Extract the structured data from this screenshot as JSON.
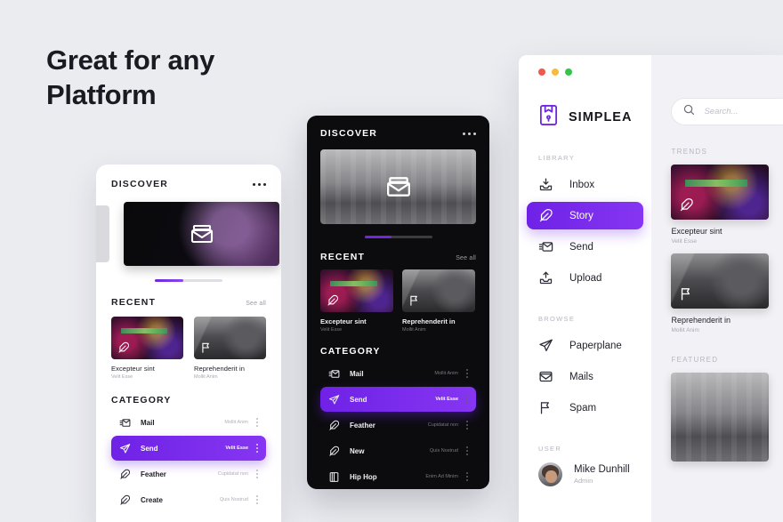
{
  "headline": {
    "line1": "Great for any",
    "line2": "Platform"
  },
  "colors": {
    "accent": "#7225e8",
    "accent_light": "#8636f2",
    "dark_bg": "#0c0c0e",
    "page_bg": "#ebecf0"
  },
  "phone_left": {
    "header_title": "DISCOVER",
    "menu_icon": "more-horizontal-icon",
    "hero_icon": "mail-icon",
    "recent": {
      "title": "RECENT",
      "see_all": "See all",
      "cards": [
        {
          "title": "Excepteur sint",
          "subtitle": "Velit Esse",
          "icon": "feather-icon"
        },
        {
          "title": "Reprehenderit in",
          "subtitle": "Mollit Anim",
          "icon": "flag-icon"
        }
      ]
    },
    "category": {
      "title": "CATEGORY",
      "items": [
        {
          "label": "Mail",
          "meta": "Mollit Anim",
          "icon": "inbox-mail-icon",
          "active": false
        },
        {
          "label": "Send",
          "meta": "Velit Esse",
          "icon": "paperplane-icon",
          "active": true
        },
        {
          "label": "Feather",
          "meta": "Cupidatat non",
          "icon": "feather-icon",
          "active": false
        },
        {
          "label": "Create",
          "meta": "Quis Nostrud",
          "icon": "feather-icon",
          "active": false
        }
      ]
    }
  },
  "phone_mid": {
    "header_title": "DISCOVER",
    "menu_icon": "more-horizontal-icon",
    "hero_icon": "mail-icon",
    "recent": {
      "title": "RECENT",
      "see_all": "See all",
      "cards": [
        {
          "title": "Excepteur sint",
          "subtitle": "Velit Esse",
          "icon": "feather-icon"
        },
        {
          "title": "Reprehenderit in",
          "subtitle": "Mollit Anim",
          "icon": "flag-icon"
        }
      ]
    },
    "category": {
      "title": "CATEGORY",
      "items": [
        {
          "label": "Mail",
          "meta": "Mollit Anim",
          "icon": "inbox-mail-icon",
          "active": false
        },
        {
          "label": "Send",
          "meta": "Velit Esse",
          "icon": "paperplane-icon",
          "active": true
        },
        {
          "label": "Feather",
          "meta": "Cupidatat non",
          "icon": "feather-icon",
          "active": false
        },
        {
          "label": "New",
          "meta": "Quis Nostrud",
          "icon": "feather-icon",
          "active": false
        },
        {
          "label": "Hip Hop",
          "meta": "Enim Ad Minim",
          "icon": "book-icon",
          "active": false
        }
      ]
    }
  },
  "desktop": {
    "window_controls": [
      {
        "name": "close",
        "color": "#f0584e"
      },
      {
        "name": "minimize",
        "color": "#f5bd3f"
      },
      {
        "name": "maximize",
        "color": "#33c549"
      }
    ],
    "brand": {
      "name": "SIMPLEA",
      "logo_icon": "mailbox-icon"
    },
    "groups": [
      {
        "label": "LIBRARY",
        "items": [
          {
            "label": "Inbox",
            "icon": "inbox-download-icon",
            "active": false
          },
          {
            "label": "Story",
            "icon": "feather-icon",
            "active": true
          },
          {
            "label": "Send",
            "icon": "send-mail-icon",
            "active": false
          },
          {
            "label": "Upload",
            "icon": "upload-icon",
            "active": false
          }
        ]
      },
      {
        "label": "BROWSE",
        "items": [
          {
            "label": "Paperplane",
            "icon": "paperplane-icon",
            "active": false
          },
          {
            "label": "Mails",
            "icon": "mail-icon",
            "active": false
          },
          {
            "label": "Spam",
            "icon": "flag-icon",
            "active": false
          }
        ]
      }
    ],
    "user_group_label": "USER",
    "user": {
      "name": "Mike Dunhill",
      "role": "Admin",
      "avatar": "user-avatar"
    },
    "search": {
      "placeholder": "Search...",
      "value": "",
      "icon": "search-icon"
    },
    "trends_label": "TRENDS",
    "featured_label": "FEATURED",
    "trend_cards": [
      {
        "title": "Excepteur sint",
        "subtitle": "Velit Esse",
        "icon": "feather-icon"
      },
      {
        "title": "Reprehenderit in",
        "subtitle": "Mollit Anim",
        "icon": "flag-icon"
      }
    ]
  }
}
